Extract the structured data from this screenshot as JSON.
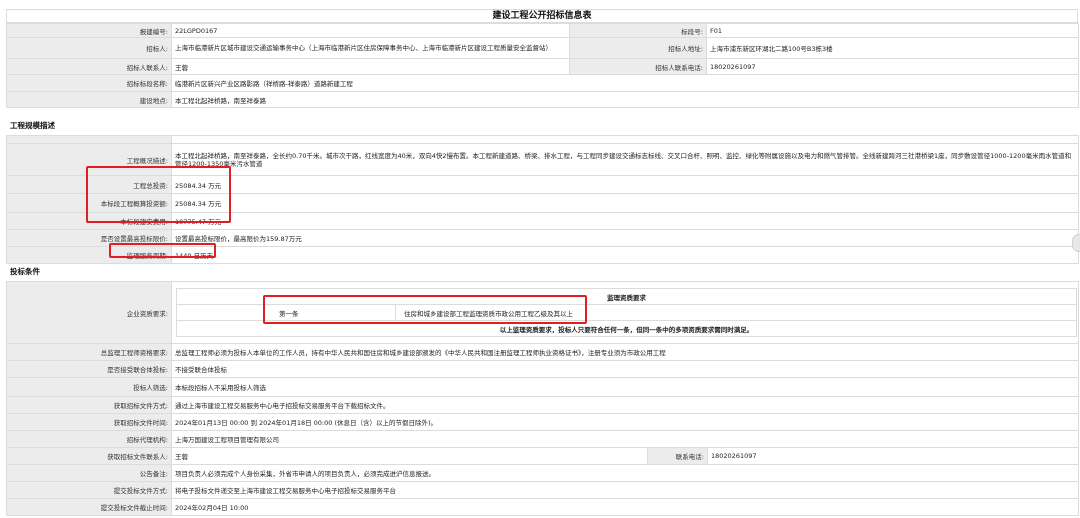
{
  "title": "建设工程公开招标信息表",
  "basic": {
    "report_no_label": "报建编号:",
    "report_no": "22LGPD0167",
    "bid_section_no_label": "标段号:",
    "bid_section_no": "F01",
    "tenderer_label": "招标人:",
    "tenderer": "上海市临港新片区城市建设交通运输事务中心（上海市临港新片区住房保障事务中心、上海市临港新片区建设工程质量安全监督站）",
    "tenderer_address_label": "招标人地址:",
    "tenderer_address": "上海市浦东新区环湖北二路100号B3栋3楼",
    "contact_label": "招标人联系人:",
    "contact": "王蓉",
    "contact_phone_label": "招标人联系电话:",
    "contact_phone": "18020261097",
    "section_name_label": "招标标段名称:",
    "section_name": "临港新片区新兴产业区路影路（祥桥路-祥泰路）道路新建工程",
    "location_label": "建设地点:",
    "location": "本工程北起祥桥路，南至祥泰路"
  },
  "scale_section": {
    "heading": "工程规模描述",
    "overview_label": "工程概况描述:",
    "overview": "本工程北起祥桥路，南至祥泰路，全长约0.70千米。城市次干路，红线宽度为40米，双向4快2慢布置。本工程新建道路、桥梁、排水工程，与工程同步建设交通标志标线、交叉口合杆、照明、监控、绿化等附属设施以及电力和燃气管排管。全线新建跨河三社港桥梁1座，同步敷设管径1000-1200毫米雨水管道和管径1200-1350毫米污水管道",
    "total_investment_label": "工程总投资:",
    "total_investment": "25084.34 万元",
    "section_estimate_label": "本标段工程概算投资额:",
    "section_estimate": "25084.34 万元",
    "section_install_label": "本标段建安费用:",
    "section_install": "10775.47 万元",
    "max_price_label": "是否设置最高投标限价:",
    "max_price": "设置最高投标限价，最高限价为159.87万元",
    "service_period_label": "监理服务周期:",
    "service_period": "1440 日历天"
  },
  "conditions": {
    "heading": "投标条件",
    "qualification_label": "企业资质要求:",
    "qual_table_header": "监理资质要求",
    "qual_rows": [
      {
        "no": "第一条",
        "req": "住房和城乡建设部工程监理资质市政公用工程乙级及其以上"
      }
    ],
    "qual_note": "以上监理资质要求，投标人只要符合任何一条，但同一条中的多项资质要求需同时满足。",
    "chief_label": "总监理工程师资格要求:",
    "chief": "总监理工程师必须为投标人本单位的工作人员，持有中华人民共和国住房和城乡建设部颁发的《中华人民共和国注册监理工程师执业资格证书》，注册专业须为市政公用工程",
    "consortium_label": "是否接受联合体投标:",
    "consortium": "不接受联合体投标",
    "screening_label": "投标人筛选:",
    "screening": "本标段招标人不采用投标人筛选",
    "doc_method_label": "获取招标文件方式:",
    "doc_method": "通过上海市建设工程交易服务中心电子招投标交易服务平台下载招标文件。",
    "doc_time_label": "获取招标文件时间:",
    "doc_time": "2024年01月13日 00:00 到 2024年01月18日 00:00 (休息日（含）以上的节假日除外)。",
    "agency_label": "招标代理机构:",
    "agency": "上海万国建设工程项目管理有限公司",
    "doc_contact_label": "获取招标文件联系人:",
    "doc_contact": "王蓉",
    "doc_phone_label": "联系电话:",
    "doc_phone": "18020261097",
    "notice_label": "公告备注:",
    "notice": "项目负责人必须完成个人身份采集，外省市申请人的项目负责人，必须完成进沪信息报送。",
    "submit_method_label": "提交投标文件方式:",
    "submit_method": "将电子投标文件递交至上海市建设工程交易服务中心电子招投标交易服务平台",
    "deadline_label": "提交投标文件截止时间:",
    "deadline": "2024年02月04日 10:00"
  }
}
